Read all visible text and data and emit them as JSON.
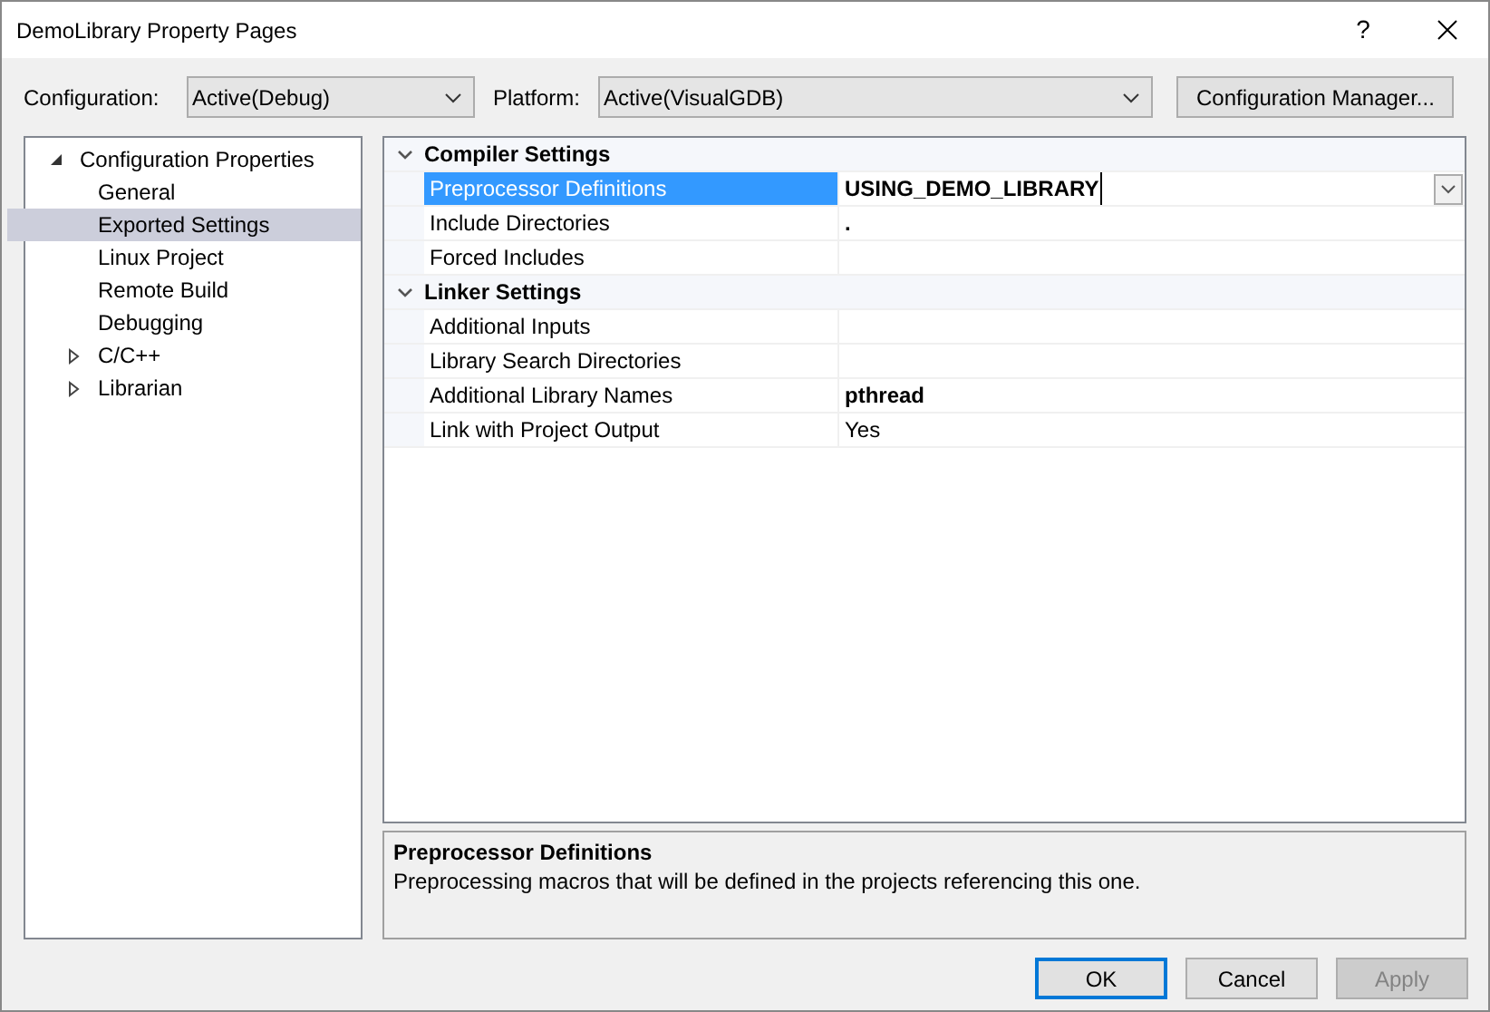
{
  "window": {
    "title": "DemoLibrary Property Pages",
    "help": "?"
  },
  "toolbar": {
    "configuration": {
      "label": "Configuration:",
      "value": "Active(Debug)"
    },
    "platform": {
      "label": "Platform:",
      "value": "Active(VisualGDB)"
    },
    "manager_button": "Configuration Manager..."
  },
  "tree": [
    {
      "label": "Configuration Properties",
      "expanded": true,
      "selected": false,
      "children": [
        {
          "label": "General",
          "selected": false
        },
        {
          "label": "Exported Settings",
          "selected": true
        },
        {
          "label": "Linux Project",
          "selected": false
        },
        {
          "label": "Remote Build",
          "selected": false
        },
        {
          "label": "Debugging",
          "selected": false
        },
        {
          "label": "C/C++",
          "selected": false,
          "expanded": false
        },
        {
          "label": "Librarian",
          "selected": false,
          "expanded": false
        }
      ]
    }
  ],
  "grid": [
    {
      "category": "Compiler Settings",
      "expanded": true,
      "rows": [
        {
          "name": "Preprocessor Definitions",
          "value": "USING_DEMO_LIBRARY",
          "modified": true,
          "selected": true
        },
        {
          "name": "Include Directories",
          "value": ".",
          "modified": true,
          "selected": false
        },
        {
          "name": "Forced Includes",
          "value": "",
          "modified": false,
          "selected": false
        }
      ]
    },
    {
      "category": "Linker Settings",
      "expanded": true,
      "rows": [
        {
          "name": "Additional Inputs",
          "value": "",
          "modified": false,
          "selected": false
        },
        {
          "name": "Library Search Directories",
          "value": "",
          "modified": false,
          "selected": false
        },
        {
          "name": "Additional Library Names",
          "value": "pthread",
          "modified": true,
          "selected": false
        },
        {
          "name": "Link with Project Output",
          "value": "Yes",
          "modified": false,
          "selected": false
        }
      ]
    }
  ],
  "description": {
    "title": "Preprocessor Definitions",
    "text": "Preprocessing macros that will be defined in the projects referencing this one."
  },
  "buttons": [
    {
      "label": "OK",
      "kind": "default",
      "disabled": false
    },
    {
      "label": "Cancel",
      "kind": "normal",
      "disabled": false
    },
    {
      "label": "Apply",
      "kind": "normal",
      "disabled": true
    }
  ]
}
